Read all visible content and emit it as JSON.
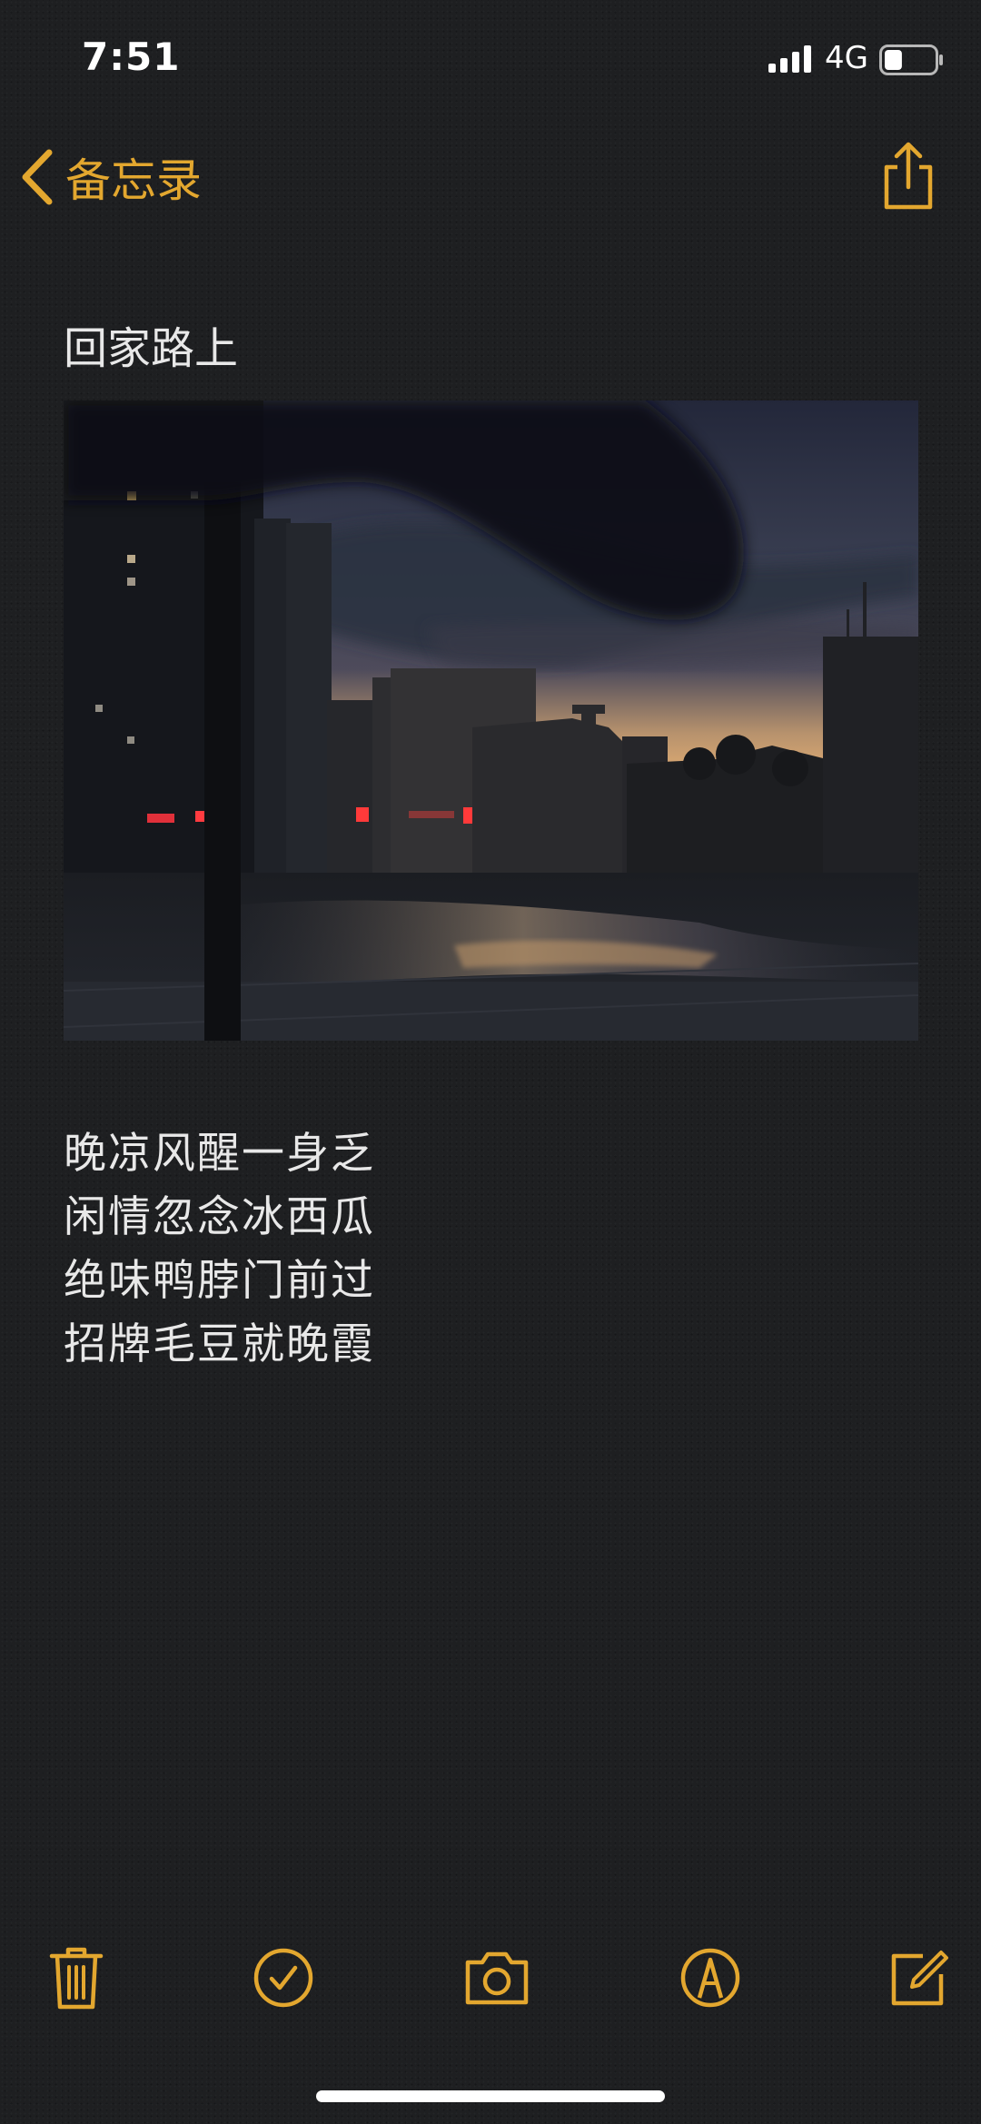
{
  "status_bar": {
    "time": "7:51",
    "network": "4G",
    "signal_bars": 4,
    "battery_level": 0.35
  },
  "nav": {
    "back_label": "备忘录",
    "back_icon": "chevron-left-icon",
    "share_icon": "share-icon"
  },
  "note": {
    "title": "回家路上",
    "image_alt": "photo-sunset-street",
    "poem": [
      "晚凉风醒一身乏",
      "闲情忽念冰西瓜",
      "绝味鸭脖门前过",
      "招牌毛豆就晚霞"
    ]
  },
  "toolbar": {
    "icons": [
      "trash-icon",
      "checklist-icon",
      "camera-icon",
      "markup-icon",
      "compose-icon"
    ]
  },
  "colors": {
    "accent": "#e3a72f",
    "background": "#1e1f21",
    "text": "#e8e8e8"
  }
}
